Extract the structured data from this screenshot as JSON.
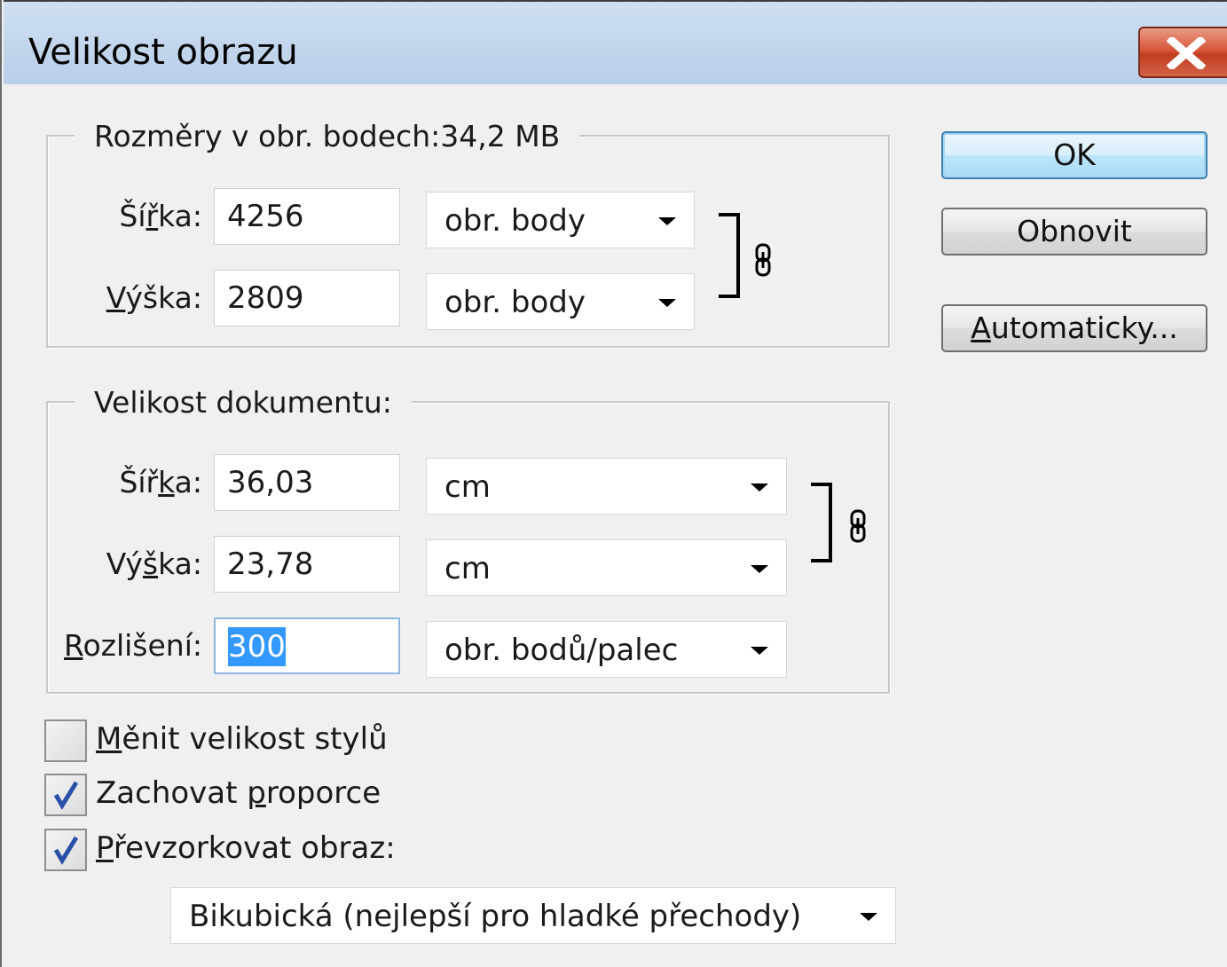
{
  "window": {
    "title": "Velikost obrazu"
  },
  "pixel_dims": {
    "legend": "Rozměry v obr. bodech:34,2 MB",
    "width_label": "Šířka:",
    "width_value": "4256",
    "width_unit": "obr. body",
    "height_label": "Výška:",
    "height_value": "2809",
    "height_unit": "obr. body"
  },
  "doc_size": {
    "legend": "Velikost dokumentu:",
    "width_label": "Šířka:",
    "width_value": "36,03",
    "width_unit": "cm",
    "height_label": "Výška:",
    "height_value": "23,78",
    "height_unit": "cm",
    "resolution_label": "Rozlišení:",
    "resolution_value": "300",
    "resolution_unit": "obr. bodů/palec"
  },
  "buttons": {
    "ok": "OK",
    "reset": "Obnovit",
    "auto": "Automaticky..."
  },
  "options": {
    "scale_styles": {
      "label": "Měnit velikost stylů",
      "checked": false
    },
    "constrain": {
      "label": "Zachovat proporce",
      "checked": true
    },
    "resample": {
      "label": "Převzorkovat obraz:",
      "checked": true
    },
    "resample_method": "Bikubická (nejlepší pro hladké přechody)"
  },
  "icons": {
    "close": "close-icon",
    "link": "chain-link-icon",
    "dropdown": "chevron-down-icon",
    "check": "checkmark-icon"
  },
  "colors": {
    "title_bar": "#c1d5ec",
    "close_button": "#c94a2e",
    "selection": "#3399ff",
    "default_button_border": "#3c7fb1"
  }
}
